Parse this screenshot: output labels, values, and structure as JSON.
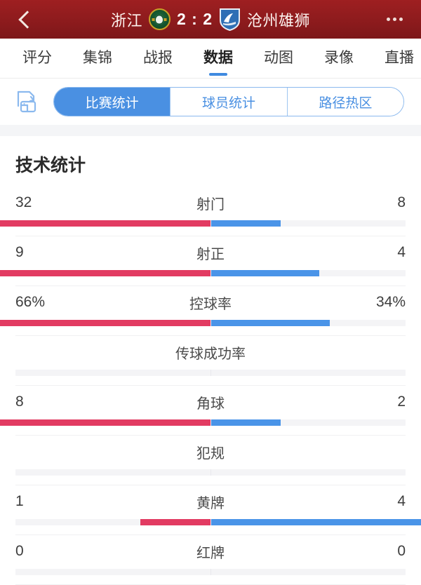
{
  "header": {
    "back_icon": "chevron-left-icon",
    "home_team": "浙江",
    "away_team": "沧州雄狮",
    "score": "2 : 2",
    "home_crest_icon": "zhejiang-crest-icon",
    "away_crest_icon": "cangzhou-crest-icon",
    "more_icon": "more-options-icon",
    "bg_color": "#8d1b1d"
  },
  "tabs": {
    "items": [
      {
        "label": "评分",
        "active": false
      },
      {
        "label": "集锦",
        "active": false
      },
      {
        "label": "战报",
        "active": false
      },
      {
        "label": "数据",
        "active": true
      },
      {
        "label": "动图",
        "active": false
      },
      {
        "label": "录像",
        "active": false
      },
      {
        "label": "直播",
        "active": false
      }
    ],
    "indicator_color": "#3f8ae0"
  },
  "segment_bar": {
    "left_icon": "flip-page-icon",
    "options": [
      {
        "label": "比赛统计",
        "active": true
      },
      {
        "label": "球员统计",
        "active": false
      },
      {
        "label": "路径热区",
        "active": false
      }
    ],
    "active_color": "#4a90e2"
  },
  "stats": {
    "title": "技术统计",
    "home_color": "#e23b62",
    "away_color": "#4a94e8",
    "rows": [
      {
        "label": "射门",
        "home": "32",
        "away": "8",
        "home_pct": 80,
        "away_pct": 20
      },
      {
        "label": "射正",
        "home": "9",
        "away": "4",
        "home_pct": 69,
        "away_pct": 31
      },
      {
        "label": "控球率",
        "home": "66%",
        "away": "34%",
        "home_pct": 66,
        "away_pct": 34
      },
      {
        "label": "传球成功率",
        "home": "",
        "away": "",
        "home_pct": 0,
        "away_pct": 0
      },
      {
        "label": "角球",
        "home": "8",
        "away": "2",
        "home_pct": 80,
        "away_pct": 20
      },
      {
        "label": "犯规",
        "home": "",
        "away": "",
        "home_pct": 0,
        "away_pct": 0
      },
      {
        "label": "黄牌",
        "home": "1",
        "away": "4",
        "home_pct": 20,
        "away_pct": 80
      },
      {
        "label": "红牌",
        "home": "0",
        "away": "0",
        "home_pct": 0,
        "away_pct": 0
      }
    ]
  },
  "chart_data": {
    "type": "bar",
    "title": "技术统计",
    "categories": [
      "射门",
      "射正",
      "控球率",
      "传球成功率",
      "角球",
      "犯规",
      "黄牌",
      "红牌"
    ],
    "series": [
      {
        "name": "浙江",
        "values": [
          32,
          9,
          66,
          null,
          8,
          null,
          1,
          0
        ]
      },
      {
        "name": "沧州雄狮",
        "values": [
          8,
          4,
          34,
          null,
          2,
          null,
          4,
          0
        ]
      }
    ],
    "orientation": "horizontal-diverging",
    "legend": "none",
    "grid": false
  }
}
